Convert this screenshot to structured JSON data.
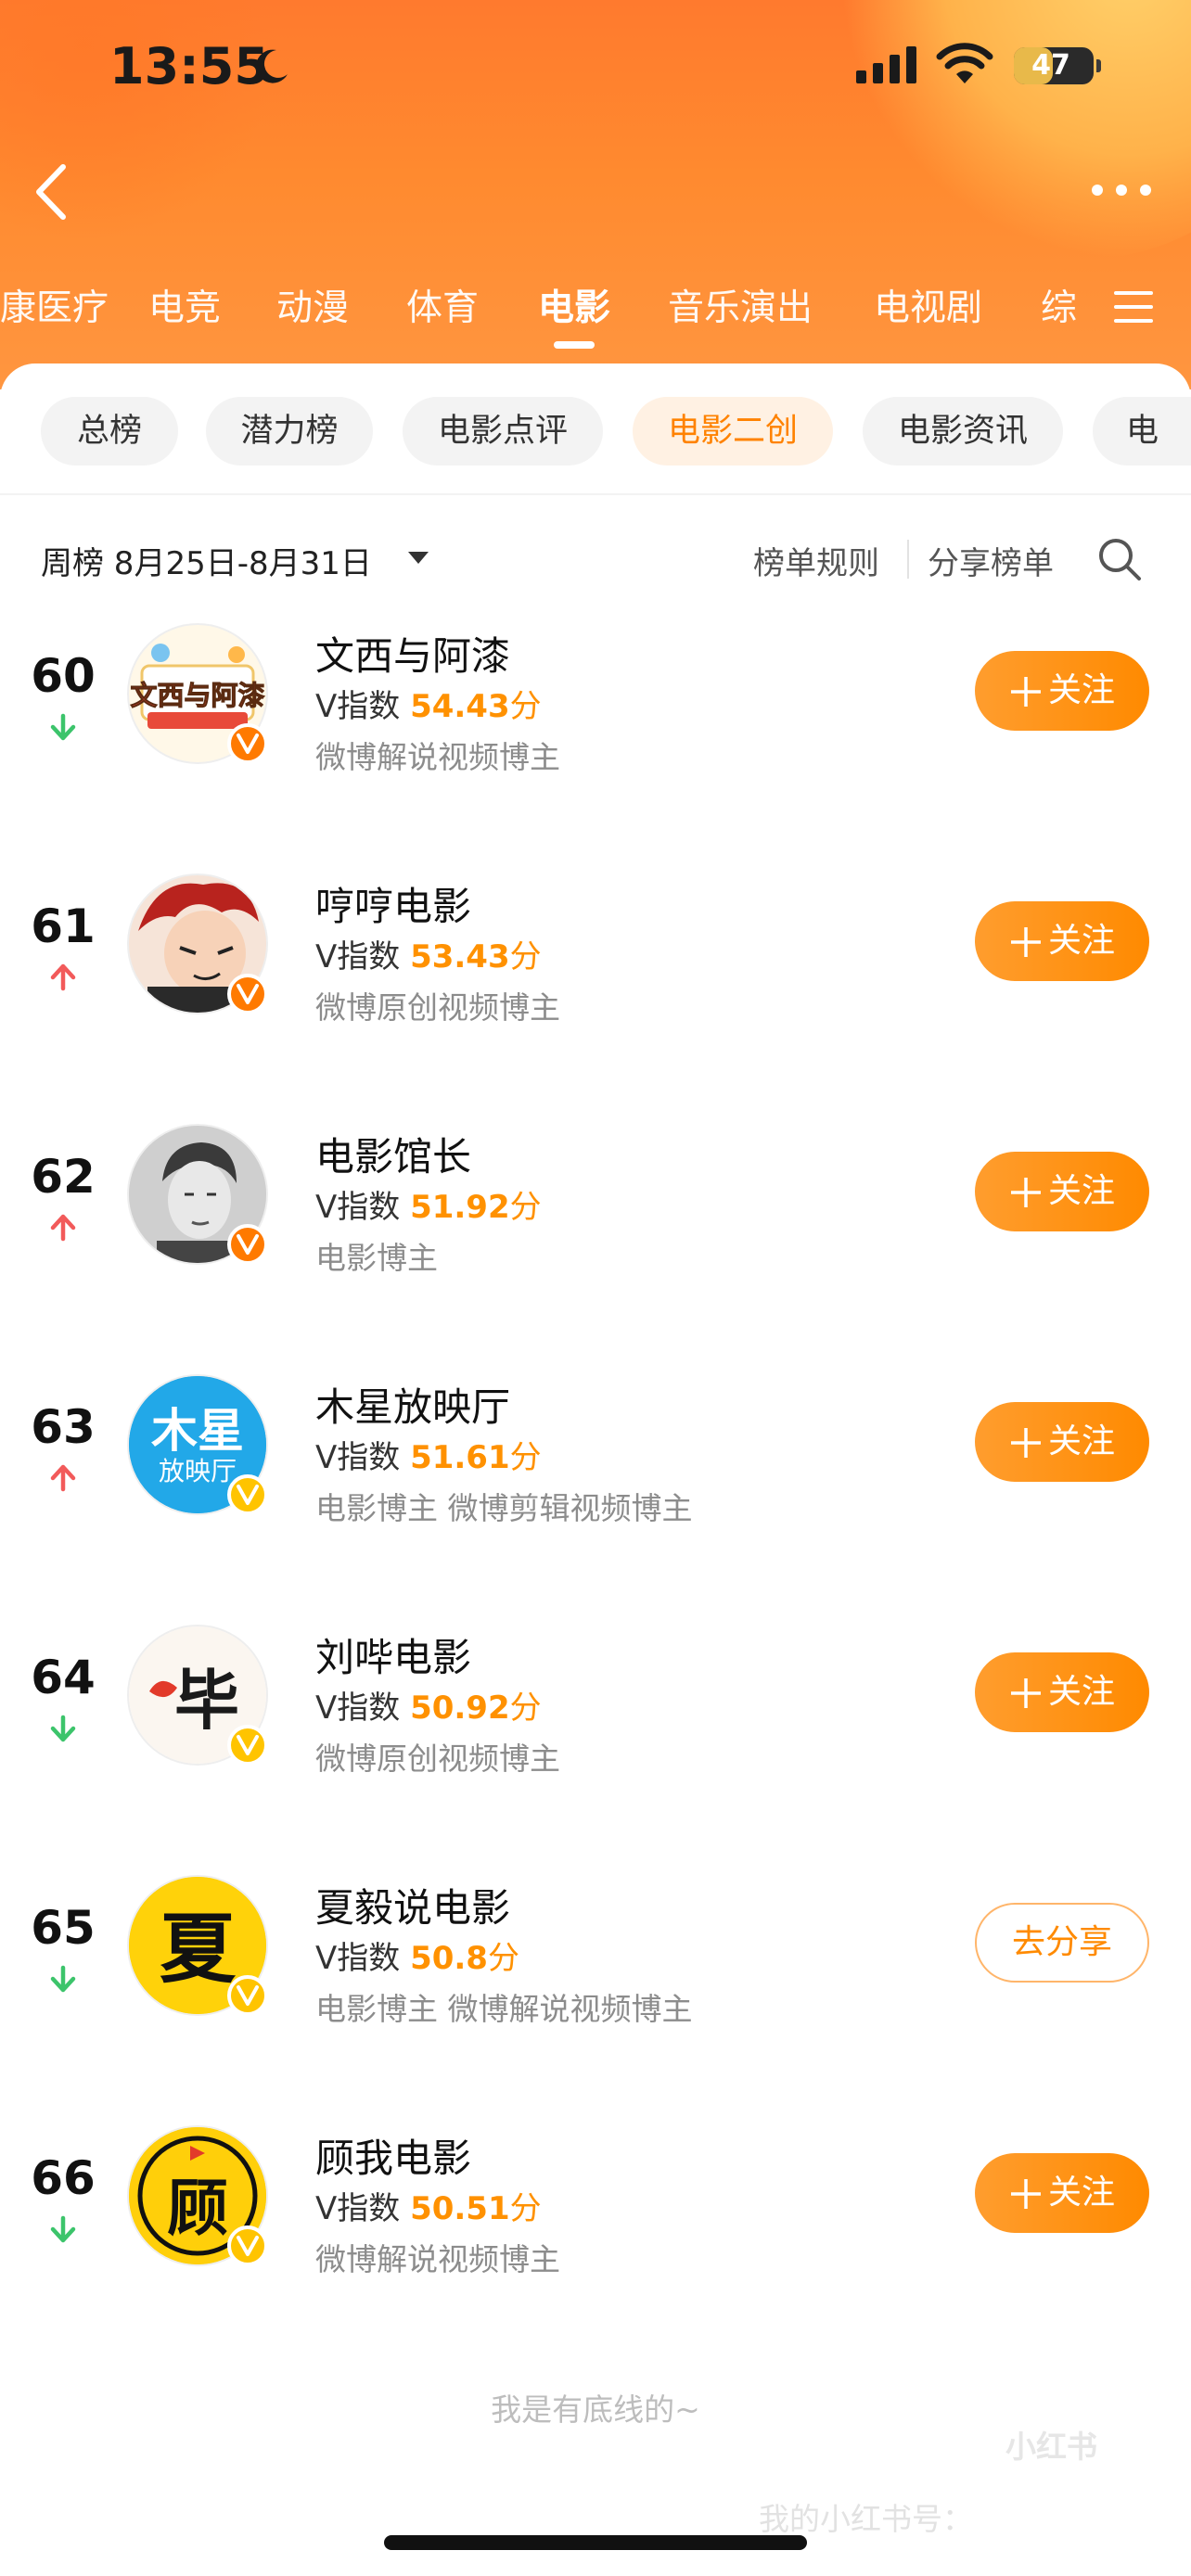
{
  "status_bar": {
    "time": "13:55",
    "battery": "47"
  },
  "categories": [
    "康医疗",
    "电竞",
    "动漫",
    "体育",
    "电影",
    "音乐演出",
    "电视剧",
    "综"
  ],
  "active_category": "电影",
  "subtabs": [
    "总榜",
    "潜力榜",
    "电影点评",
    "电影二创",
    "电影资讯",
    "电"
  ],
  "active_subtab": "电影二创",
  "filter": {
    "period": "周榜 8月25日-8月31日",
    "rules": "榜单规则",
    "share": "分享榜单"
  },
  "entries": [
    {
      "rank": "60",
      "trend": "down",
      "name": "文西与阿漆",
      "vindex_label": "V指数",
      "score": "54.43",
      "unit": "分",
      "desc": "微博解说视频博主",
      "action": "关注",
      "badge": "orange"
    },
    {
      "rank": "61",
      "trend": "up",
      "name": "哼哼电影",
      "vindex_label": "V指数",
      "score": "53.43",
      "unit": "分",
      "desc": "微博原创视频博主",
      "action": "关注",
      "badge": "orange"
    },
    {
      "rank": "62",
      "trend": "up",
      "name": "电影馆长",
      "vindex_label": "V指数",
      "score": "51.92",
      "unit": "分",
      "desc": "电影博主",
      "action": "关注",
      "badge": "orange"
    },
    {
      "rank": "63",
      "trend": "up",
      "name": "木星放映厅",
      "vindex_label": "V指数",
      "score": "51.61",
      "unit": "分",
      "desc": "电影博主 微博剪辑视频博主",
      "action": "关注",
      "badge": "gold"
    },
    {
      "rank": "64",
      "trend": "down",
      "name": "刘哔电影",
      "vindex_label": "V指数",
      "score": "50.92",
      "unit": "分",
      "desc": "微博原创视频博主",
      "action": "关注",
      "badge": "gold"
    },
    {
      "rank": "65",
      "trend": "down",
      "name": "夏毅说电影",
      "vindex_label": "V指数",
      "score": "50.8",
      "unit": "分",
      "desc": "电影博主 微博解说视频博主",
      "action": "去分享",
      "badge": "gold"
    },
    {
      "rank": "66",
      "trend": "down",
      "name": "顾我电影",
      "vindex_label": "V指数",
      "score": "50.51",
      "unit": "分",
      "desc": "微博解说视频博主",
      "action": "关注",
      "badge": "gold"
    }
  ],
  "avatar_art": {
    "a60": "文西与阿漆",
    "a63_main": "木星",
    "a63_sub": "放映厅",
    "a64": "毕",
    "a65": "夏",
    "a66": "顾"
  },
  "footer": "我是有底线的~",
  "watermark": {
    "logo": "小红书",
    "text": "我的小红书号："
  },
  "colors": {
    "accent": "#ff8a00",
    "up": "#f25a5a",
    "down": "#3cc46b",
    "badge_orange": "#ff7a00",
    "badge_gold": "#ffc400"
  }
}
